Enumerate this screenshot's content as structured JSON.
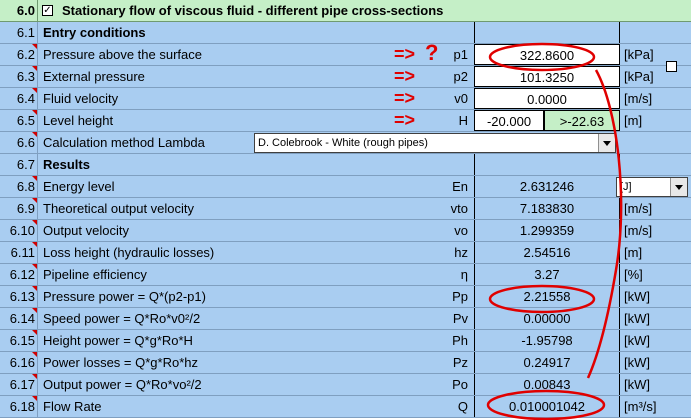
{
  "header": {
    "section": "6.0",
    "checkbox_mark": "✓",
    "title": "Stationary flow of viscous fluid - different pipe cross-sections"
  },
  "entry": {
    "section": "6.1",
    "title": "Entry conditions",
    "rows": [
      {
        "num": "6.2",
        "label": "Pressure above the surface",
        "arrow": "=>",
        "qmark": "?",
        "symbol": "p1",
        "value": "322.8600",
        "unit": "[kPa]"
      },
      {
        "num": "6.3",
        "label": "External pressure",
        "arrow": "=>",
        "symbol": "p2",
        "value": "101.3250",
        "unit": "[kPa]"
      },
      {
        "num": "6.4",
        "label": "Fluid velocity",
        "arrow": "=>",
        "symbol": "v0",
        "value": "0.0000",
        "unit": "[m/s]"
      },
      {
        "num": "6.5",
        "label": "Level height",
        "arrow": "=>",
        "symbol": "H",
        "value": "-20.000",
        "value2": ">-22.63",
        "unit": "[m]"
      },
      {
        "num": "6.6",
        "label": "Calculation method Lambda",
        "dropdown": "D. Colebrook - White (rough pipes)"
      }
    ]
  },
  "results": {
    "section": "6.7",
    "title": "Results",
    "energy_unit_dropdown": "[J]",
    "rows": [
      {
        "num": "6.8",
        "label": "Energy level",
        "symbol": "En",
        "value": "2.631246",
        "unit": ""
      },
      {
        "num": "6.9",
        "label": "Theoretical output velocity",
        "symbol": "vto",
        "value": "7.183830",
        "unit": "[m/s]"
      },
      {
        "num": "6.10",
        "label": "Output velocity",
        "symbol": "vo",
        "value": "1.299359",
        "unit": "[m/s]"
      },
      {
        "num": "6.11",
        "label": "Loss height (hydraulic losses)",
        "symbol": "hz",
        "value": "2.54516",
        "unit": "[m]"
      },
      {
        "num": "6.12",
        "label": "Pipeline efficiency",
        "symbol": "η",
        "value": "3.27",
        "unit": "[%]"
      },
      {
        "num": "6.13",
        "label": "Pressure power = Q*(p2-p1)",
        "symbol": "Pp",
        "value": "2.21558",
        "unit": "[kW]"
      },
      {
        "num": "6.14",
        "label": "Speed power = Q*Ro*v0²/2",
        "symbol": "Pv",
        "value": "0.00000",
        "unit": "[kW]"
      },
      {
        "num": "6.15",
        "label": "Height power = Q*g*Ro*H",
        "symbol": "Ph",
        "value": "-1.95798",
        "unit": "[kW]"
      },
      {
        "num": "6.16",
        "label": "Power losses = Q*g*Ro*hz",
        "symbol": "Pz",
        "value": "0.24917",
        "unit": "[kW]"
      },
      {
        "num": "6.17",
        "label": "Output power = Q*Ro*vo²/2",
        "symbol": "Po",
        "value": "0.00843",
        "unit": "[kW]"
      },
      {
        "num": "6.18",
        "label": "Flow Rate",
        "symbol": "Q",
        "value": "0.010001042",
        "unit": "[m³/s]"
      }
    ]
  },
  "colors": {
    "sheet_blue": "#a9cdf1",
    "header_green": "#c5efc7",
    "input_green": "#c5efc7",
    "annotation_red": "#e00000"
  }
}
